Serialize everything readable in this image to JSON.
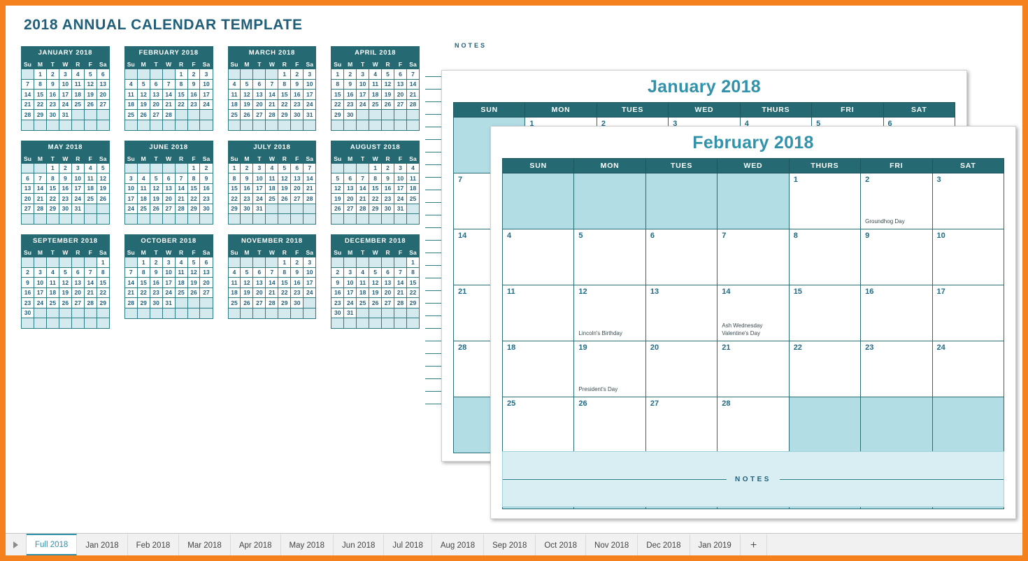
{
  "title": "2018 ANNUAL CALENDAR TEMPLATE",
  "colors": {
    "frame": "#f4801e",
    "header_teal": "#256a73",
    "title_blue": "#1f5f7a",
    "sheet_title": "#3092ab",
    "pad_fill": "#b2dde5",
    "mini_pad": "#d5eaef",
    "notes_fill": "#d9eef3"
  },
  "notes_panel": {
    "label": "NOTES"
  },
  "mini_calendars": {
    "weekday_headers": [
      "Su",
      "M",
      "T",
      "W",
      "R",
      "F",
      "Sa"
    ],
    "months": [
      {
        "title": "JANUARY 2018",
        "lead_blanks": 1,
        "days": 31
      },
      {
        "title": "FEBRUARY 2018",
        "lead_blanks": 4,
        "days": 28
      },
      {
        "title": "MARCH 2018",
        "lead_blanks": 4,
        "days": 31
      },
      {
        "title": "APRIL 2018",
        "lead_blanks": 0,
        "days": 30
      },
      {
        "title": "MAY 2018",
        "lead_blanks": 2,
        "days": 31
      },
      {
        "title": "JUNE 2018",
        "lead_blanks": 5,
        "days": 30
      },
      {
        "title": "JULY 2018",
        "lead_blanks": 0,
        "days": 31
      },
      {
        "title": "AUGUST 2018",
        "lead_blanks": 3,
        "days": 31
      },
      {
        "title": "SEPTEMBER 2018",
        "lead_blanks": 6,
        "days": 30
      },
      {
        "title": "OCTOBER 2018",
        "lead_blanks": 1,
        "days": 31
      },
      {
        "title": "NOVEMBER 2018",
        "lead_blanks": 4,
        "days": 30
      },
      {
        "title": "DECEMBER 2018",
        "lead_blanks": 6,
        "days": 31
      }
    ]
  },
  "big_calendars": [
    {
      "id": "january",
      "title": "January 2018",
      "weekday_headers": [
        "SUN",
        "MON",
        "TUES",
        "WED",
        "THURS",
        "FRI",
        "SAT"
      ],
      "lead_blanks": 1,
      "days": 31,
      "trailing_pad": true,
      "events": {}
    },
    {
      "id": "february",
      "title": "February 2018",
      "weekday_headers": [
        "SUN",
        "MON",
        "TUES",
        "WED",
        "THURS",
        "FRI",
        "SAT"
      ],
      "lead_blanks": 4,
      "days": 28,
      "trailing_pad": true,
      "notes_label": "NOTES",
      "events": {
        "2": [
          "Groundhog Day"
        ],
        "12": [
          "Lincoln's Birthday"
        ],
        "14": [
          "Ash Wednesday",
          "Valentine's Day"
        ],
        "19": [
          "President's Day"
        ]
      }
    }
  ],
  "tabbar": {
    "scroll_icon": "triangle-right-icon",
    "tabs": [
      {
        "label": "Full 2018",
        "active": true
      },
      {
        "label": "Jan 2018",
        "active": false
      },
      {
        "label": "Feb 2018",
        "active": false
      },
      {
        "label": "Mar 2018",
        "active": false
      },
      {
        "label": "Apr 2018",
        "active": false
      },
      {
        "label": "May 2018",
        "active": false
      },
      {
        "label": "Jun 2018",
        "active": false
      },
      {
        "label": "Jul 2018",
        "active": false
      },
      {
        "label": "Aug 2018",
        "active": false
      },
      {
        "label": "Sep 2018",
        "active": false
      },
      {
        "label": "Oct 2018",
        "active": false
      },
      {
        "label": "Nov 2018",
        "active": false
      },
      {
        "label": "Dec 2018",
        "active": false
      },
      {
        "label": "Jan 2019",
        "active": false
      }
    ],
    "add_tab_label": "+"
  }
}
